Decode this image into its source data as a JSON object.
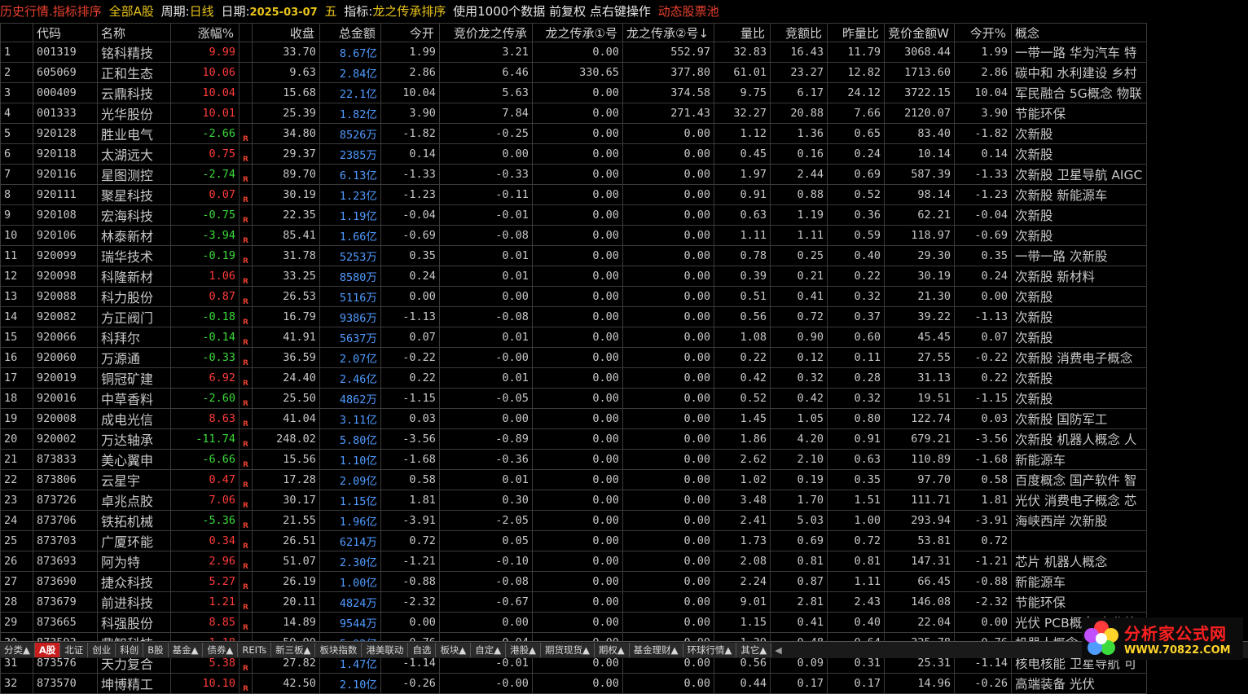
{
  "topbar": {
    "title": "历史行情.指标排序",
    "market": "全部A股",
    "period_label": "周期:",
    "period": "日线",
    "date_label": "日期:",
    "date": "2025-03-07",
    "weekday": "五",
    "indicator_label": "指标:",
    "indicator": "龙之传承排序",
    "info": "使用1000个数据 前复权 点右键操作",
    "pool": "动态股票池"
  },
  "columns": [
    "",
    "代码",
    "名称",
    "涨幅%",
    "",
    "收盘",
    "总金额",
    "今开",
    "竞价龙之传承",
    "龙之传承①号",
    "龙之传承②号↓",
    "量比",
    "竞额比",
    "昨量比",
    "竞价金额W",
    "今开%",
    "概念"
  ],
  "rows": [
    {
      "idx": "1",
      "code": "001319",
      "name": "铭科精技",
      "chg": "9.99",
      "dir": "up",
      "flag": "",
      "close": "33.70",
      "amount": "8.67亿",
      "open": "1.99",
      "bid": "3.21",
      "l1": "0.00",
      "l2": "552.97",
      "vr": "32.83",
      "br": "16.43",
      "pvr": "11.79",
      "bamt": "3068.44",
      "openpct": "1.99",
      "concept": "一带一路 华为汽车 特"
    },
    {
      "idx": "2",
      "code": "605069",
      "name": "正和生态",
      "chg": "10.06",
      "dir": "up",
      "flag": "",
      "close": "9.63",
      "amount": "2.84亿",
      "open": "2.86",
      "bid": "6.46",
      "l1": "330.65",
      "l2": "377.80",
      "vr": "61.01",
      "br": "23.27",
      "pvr": "12.82",
      "bamt": "1713.60",
      "openpct": "2.86",
      "concept": "碳中和 水利建设 乡村"
    },
    {
      "idx": "3",
      "code": "000409",
      "name": "云鼎科技",
      "chg": "10.04",
      "dir": "up",
      "flag": "",
      "close": "15.68",
      "amount": "22.1亿",
      "open": "10.04",
      "bid": "5.63",
      "l1": "0.00",
      "l2": "374.58",
      "vr": "9.75",
      "br": "6.17",
      "pvr": "24.12",
      "bamt": "3722.15",
      "openpct": "10.04",
      "concept": "军民融合 5G概念 物联"
    },
    {
      "idx": "4",
      "code": "001333",
      "name": "光华股份",
      "chg": "10.01",
      "dir": "up",
      "flag": "",
      "close": "25.39",
      "amount": "1.82亿",
      "open": "3.90",
      "bid": "7.84",
      "l1": "0.00",
      "l2": "271.43",
      "vr": "32.27",
      "br": "20.88",
      "pvr": "7.66",
      "bamt": "2120.07",
      "openpct": "3.90",
      "concept": "节能环保"
    },
    {
      "idx": "5",
      "code": "920128",
      "name": "胜业电气",
      "chg": "-2.66",
      "dir": "dn",
      "flag": "R",
      "close": "34.80",
      "amount": "8526万",
      "open": "-1.82",
      "bid": "-0.25",
      "l1": "0.00",
      "l2": "0.00",
      "vr": "1.12",
      "br": "1.36",
      "pvr": "0.65",
      "bamt": "83.40",
      "openpct": "-1.82",
      "concept": "次新股"
    },
    {
      "idx": "6",
      "code": "920118",
      "name": "太湖远大",
      "chg": "0.75",
      "dir": "up",
      "flag": "R",
      "close": "29.37",
      "amount": "2385万",
      "open": "0.14",
      "bid": "0.00",
      "l1": "0.00",
      "l2": "0.00",
      "vr": "0.45",
      "br": "0.16",
      "pvr": "0.24",
      "bamt": "10.14",
      "openpct": "0.14",
      "concept": "次新股"
    },
    {
      "idx": "7",
      "code": "920116",
      "name": "星图测控",
      "chg": "-2.74",
      "dir": "dn",
      "flag": "R",
      "close": "89.70",
      "amount": "6.13亿",
      "open": "-1.33",
      "bid": "-0.33",
      "l1": "0.00",
      "l2": "0.00",
      "vr": "1.97",
      "br": "2.44",
      "pvr": "0.69",
      "bamt": "587.39",
      "openpct": "-1.33",
      "concept": "次新股 卫星导航 AIGC"
    },
    {
      "idx": "8",
      "code": "920111",
      "name": "聚星科技",
      "chg": "0.07",
      "dir": "up",
      "flag": "R",
      "close": "30.19",
      "amount": "1.23亿",
      "open": "-1.23",
      "bid": "-0.11",
      "l1": "0.00",
      "l2": "0.00",
      "vr": "0.91",
      "br": "0.88",
      "pvr": "0.52",
      "bamt": "98.14",
      "openpct": "-1.23",
      "concept": "次新股 新能源车"
    },
    {
      "idx": "9",
      "code": "920108",
      "name": "宏海科技",
      "chg": "-0.75",
      "dir": "dn",
      "flag": "R",
      "close": "22.35",
      "amount": "1.19亿",
      "open": "-0.04",
      "bid": "-0.01",
      "l1": "0.00",
      "l2": "0.00",
      "vr": "0.63",
      "br": "1.19",
      "pvr": "0.36",
      "bamt": "62.21",
      "openpct": "-0.04",
      "concept": "次新股"
    },
    {
      "idx": "10",
      "code": "920106",
      "name": "林泰新材",
      "chg": "-3.94",
      "dir": "dn",
      "flag": "R",
      "close": "85.41",
      "amount": "1.66亿",
      "open": "-0.69",
      "bid": "-0.08",
      "l1": "0.00",
      "l2": "0.00",
      "vr": "1.11",
      "br": "1.11",
      "pvr": "0.59",
      "bamt": "118.97",
      "openpct": "-0.69",
      "concept": "次新股"
    },
    {
      "idx": "11",
      "code": "920099",
      "name": "瑞华技术",
      "chg": "-0.19",
      "dir": "dn",
      "flag": "R",
      "close": "31.78",
      "amount": "5253万",
      "open": "0.35",
      "bid": "0.01",
      "l1": "0.00",
      "l2": "0.00",
      "vr": "0.78",
      "br": "0.25",
      "pvr": "0.40",
      "bamt": "29.30",
      "openpct": "0.35",
      "concept": "一带一路 次新股"
    },
    {
      "idx": "12",
      "code": "920098",
      "name": "科隆新材",
      "chg": "1.06",
      "dir": "up",
      "flag": "R",
      "close": "33.25",
      "amount": "8580万",
      "open": "0.24",
      "bid": "0.01",
      "l1": "0.00",
      "l2": "0.00",
      "vr": "0.39",
      "br": "0.21",
      "pvr": "0.22",
      "bamt": "30.19",
      "openpct": "0.24",
      "concept": "次新股 新材料"
    },
    {
      "idx": "13",
      "code": "920088",
      "name": "科力股份",
      "chg": "0.87",
      "dir": "up",
      "flag": "R",
      "close": "26.53",
      "amount": "5116万",
      "open": "0.00",
      "bid": "0.00",
      "l1": "0.00",
      "l2": "0.00",
      "vr": "0.51",
      "br": "0.41",
      "pvr": "0.32",
      "bamt": "21.30",
      "openpct": "0.00",
      "concept": "次新股"
    },
    {
      "idx": "14",
      "code": "920082",
      "name": "方正阀门",
      "chg": "-0.18",
      "dir": "dn",
      "flag": "R",
      "close": "16.79",
      "amount": "9386万",
      "open": "-1.13",
      "bid": "-0.08",
      "l1": "0.00",
      "l2": "0.00",
      "vr": "0.56",
      "br": "0.72",
      "pvr": "0.37",
      "bamt": "39.22",
      "openpct": "-1.13",
      "concept": "次新股"
    },
    {
      "idx": "15",
      "code": "920066",
      "name": "科拜尔",
      "chg": "-0.14",
      "dir": "dn",
      "flag": "R",
      "close": "41.91",
      "amount": "5637万",
      "open": "0.07",
      "bid": "0.01",
      "l1": "0.00",
      "l2": "0.00",
      "vr": "1.08",
      "br": "0.90",
      "pvr": "0.60",
      "bamt": "45.45",
      "openpct": "0.07",
      "concept": "次新股"
    },
    {
      "idx": "16",
      "code": "920060",
      "name": "万源通",
      "chg": "-0.33",
      "dir": "dn",
      "flag": "R",
      "close": "36.59",
      "amount": "2.07亿",
      "open": "-0.22",
      "bid": "-0.00",
      "l1": "0.00",
      "l2": "0.00",
      "vr": "0.22",
      "br": "0.12",
      "pvr": "0.11",
      "bamt": "27.55",
      "openpct": "-0.22",
      "concept": "次新股 消费电子概念"
    },
    {
      "idx": "17",
      "code": "920019",
      "name": "铜冠矿建",
      "chg": "6.92",
      "dir": "up",
      "flag": "R",
      "close": "24.40",
      "amount": "2.46亿",
      "open": "0.22",
      "bid": "0.01",
      "l1": "0.00",
      "l2": "0.00",
      "vr": "0.42",
      "br": "0.32",
      "pvr": "0.28",
      "bamt": "31.13",
      "openpct": "0.22",
      "concept": "次新股"
    },
    {
      "idx": "18",
      "code": "920016",
      "name": "中草香料",
      "chg": "-2.60",
      "dir": "dn",
      "flag": "R",
      "close": "25.50",
      "amount": "4862万",
      "open": "-1.15",
      "bid": "-0.05",
      "l1": "0.00",
      "l2": "0.00",
      "vr": "0.52",
      "br": "0.42",
      "pvr": "0.32",
      "bamt": "19.51",
      "openpct": "-1.15",
      "concept": "次新股"
    },
    {
      "idx": "19",
      "code": "920008",
      "name": "成电光信",
      "chg": "8.63",
      "dir": "up",
      "flag": "R",
      "close": "41.04",
      "amount": "3.11亿",
      "open": "0.03",
      "bid": "0.00",
      "l1": "0.00",
      "l2": "0.00",
      "vr": "1.45",
      "br": "1.05",
      "pvr": "0.80",
      "bamt": "122.74",
      "openpct": "0.03",
      "concept": "次新股 国防军工"
    },
    {
      "idx": "20",
      "code": "920002",
      "name": "万达轴承",
      "chg": "-11.74",
      "dir": "dn",
      "flag": "R",
      "close": "248.02",
      "amount": "5.80亿",
      "open": "-3.56",
      "bid": "-0.89",
      "l1": "0.00",
      "l2": "0.00",
      "vr": "1.86",
      "br": "4.20",
      "pvr": "0.91",
      "bamt": "679.21",
      "openpct": "-3.56",
      "concept": "次新股 机器人概念 人"
    },
    {
      "idx": "21",
      "code": "873833",
      "name": "美心翼申",
      "chg": "-6.66",
      "dir": "dn",
      "flag": "R",
      "close": "15.56",
      "amount": "1.10亿",
      "open": "-1.68",
      "bid": "-0.36",
      "l1": "0.00",
      "l2": "0.00",
      "vr": "2.62",
      "br": "2.10",
      "pvr": "0.63",
      "bamt": "110.89",
      "openpct": "-1.68",
      "concept": "新能源车"
    },
    {
      "idx": "22",
      "code": "873806",
      "name": "云星宇",
      "chg": "0.47",
      "dir": "up",
      "flag": "R",
      "close": "17.28",
      "amount": "2.09亿",
      "open": "0.58",
      "bid": "0.01",
      "l1": "0.00",
      "l2": "0.00",
      "vr": "1.02",
      "br": "0.19",
      "pvr": "0.35",
      "bamt": "97.70",
      "openpct": "0.58",
      "concept": "百度概念 国产软件 智"
    },
    {
      "idx": "23",
      "code": "873726",
      "name": "卓兆点胶",
      "chg": "7.06",
      "dir": "up",
      "flag": "R",
      "close": "30.17",
      "amount": "1.15亿",
      "open": "1.81",
      "bid": "0.30",
      "l1": "0.00",
      "l2": "0.00",
      "vr": "3.48",
      "br": "1.70",
      "pvr": "1.51",
      "bamt": "111.71",
      "openpct": "1.81",
      "concept": "光伏 消费电子概念 芯"
    },
    {
      "idx": "24",
      "code": "873706",
      "name": "铁拓机械",
      "chg": "-5.36",
      "dir": "dn",
      "flag": "R",
      "close": "21.55",
      "amount": "1.96亿",
      "open": "-3.91",
      "bid": "-2.05",
      "l1": "0.00",
      "l2": "0.00",
      "vr": "2.41",
      "br": "5.03",
      "pvr": "1.00",
      "bamt": "293.94",
      "openpct": "-3.91",
      "concept": "海峡西岸 次新股"
    },
    {
      "idx": "25",
      "code": "873703",
      "name": "广厦环能",
      "chg": "0.34",
      "dir": "up",
      "flag": "R",
      "close": "26.51",
      "amount": "6214万",
      "open": "0.72",
      "bid": "0.05",
      "l1": "0.00",
      "l2": "0.00",
      "vr": "1.73",
      "br": "0.69",
      "pvr": "0.72",
      "bamt": "53.81",
      "openpct": "0.72",
      "concept": ""
    },
    {
      "idx": "26",
      "code": "873693",
      "name": "阿为特",
      "chg": "2.96",
      "dir": "up",
      "flag": "R",
      "close": "51.07",
      "amount": "2.30亿",
      "open": "-1.21",
      "bid": "-0.10",
      "l1": "0.00",
      "l2": "0.00",
      "vr": "2.08",
      "br": "0.81",
      "pvr": "0.81",
      "bamt": "147.31",
      "openpct": "-1.21",
      "concept": "芯片 机器人概念"
    },
    {
      "idx": "27",
      "code": "873690",
      "name": "捷众科技",
      "chg": "5.27",
      "dir": "up",
      "flag": "R",
      "close": "26.19",
      "amount": "1.00亿",
      "open": "-0.88",
      "bid": "-0.08",
      "l1": "0.00",
      "l2": "0.00",
      "vr": "2.24",
      "br": "0.87",
      "pvr": "1.11",
      "bamt": "66.45",
      "openpct": "-0.88",
      "concept": "新能源车"
    },
    {
      "idx": "28",
      "code": "873679",
      "name": "前进科技",
      "chg": "1.21",
      "dir": "up",
      "flag": "R",
      "close": "20.11",
      "amount": "4824万",
      "open": "-2.32",
      "bid": "-0.67",
      "l1": "0.00",
      "l2": "0.00",
      "vr": "9.01",
      "br": "2.81",
      "pvr": "2.43",
      "bamt": "146.08",
      "openpct": "-2.32",
      "concept": "节能环保"
    },
    {
      "idx": "29",
      "code": "873665",
      "name": "科强股份",
      "chg": "8.85",
      "dir": "up",
      "flag": "R",
      "close": "14.89",
      "amount": "9544万",
      "open": "0.00",
      "bid": "0.00",
      "l1": "0.00",
      "l2": "0.00",
      "vr": "1.15",
      "br": "0.41",
      "pvr": "0.40",
      "bamt": "22.04",
      "openpct": "0.00",
      "concept": "光伏 PCB概念 商业航?"
    },
    {
      "idx": "30",
      "code": "873593",
      "name": "鼎智科技",
      "chg": "1.18",
      "dir": "up",
      "flag": "R",
      "close": "59.90",
      "amount": "5.02亿",
      "open": "0.76",
      "bid": "0.04",
      "l1": "0.00",
      "l2": "0.00",
      "vr": "1.39",
      "br": "0.48",
      "pvr": "0.64",
      "bamt": "325.78",
      "openpct": "0.76",
      "concept": "机器人概念 减速器 人"
    },
    {
      "idx": "31",
      "code": "873576",
      "name": "天力复合",
      "chg": "5.38",
      "dir": "up",
      "flag": "R",
      "close": "27.82",
      "amount": "1.47亿",
      "open": "-1.14",
      "bid": "-0.01",
      "l1": "0.00",
      "l2": "0.00",
      "vr": "0.56",
      "br": "0.09",
      "pvr": "0.31",
      "bamt": "25.31",
      "openpct": "-1.14",
      "concept": "核电核能 卫星导航 可"
    },
    {
      "idx": "32",
      "code": "873570",
      "name": "坤博精工",
      "chg": "10.10",
      "dir": "up",
      "flag": "R",
      "close": "42.50",
      "amount": "2.10亿",
      "open": "-0.26",
      "bid": "-0.00",
      "l1": "0.00",
      "l2": "0.00",
      "vr": "0.44",
      "br": "0.17",
      "pvr": "0.17",
      "bamt": "14.96",
      "openpct": "-0.26",
      "concept": "高端装备 光伏"
    }
  ],
  "tabs": [
    "分类▲",
    "A股",
    "北证",
    "创业",
    "科创",
    "B股",
    "基金▲",
    "债券▲",
    "REITs",
    "新三板▲",
    "板块指数",
    "港美联动",
    "自选",
    "板块▲",
    "自定▲",
    "港股▲",
    "期货现货▲",
    "期权▲",
    "基金理财▲",
    "环球行情▲",
    "其它▲"
  ],
  "active_tab_index": 1,
  "watermark": {
    "title": "分析家公式网",
    "url": "WWW.70822.COM"
  },
  "colors": {
    "up": "#ff3b3b",
    "down": "#3adb3a",
    "amount": "#4f9bff",
    "title_red": "#e8402e",
    "title_yellow": "#e8c41a"
  }
}
